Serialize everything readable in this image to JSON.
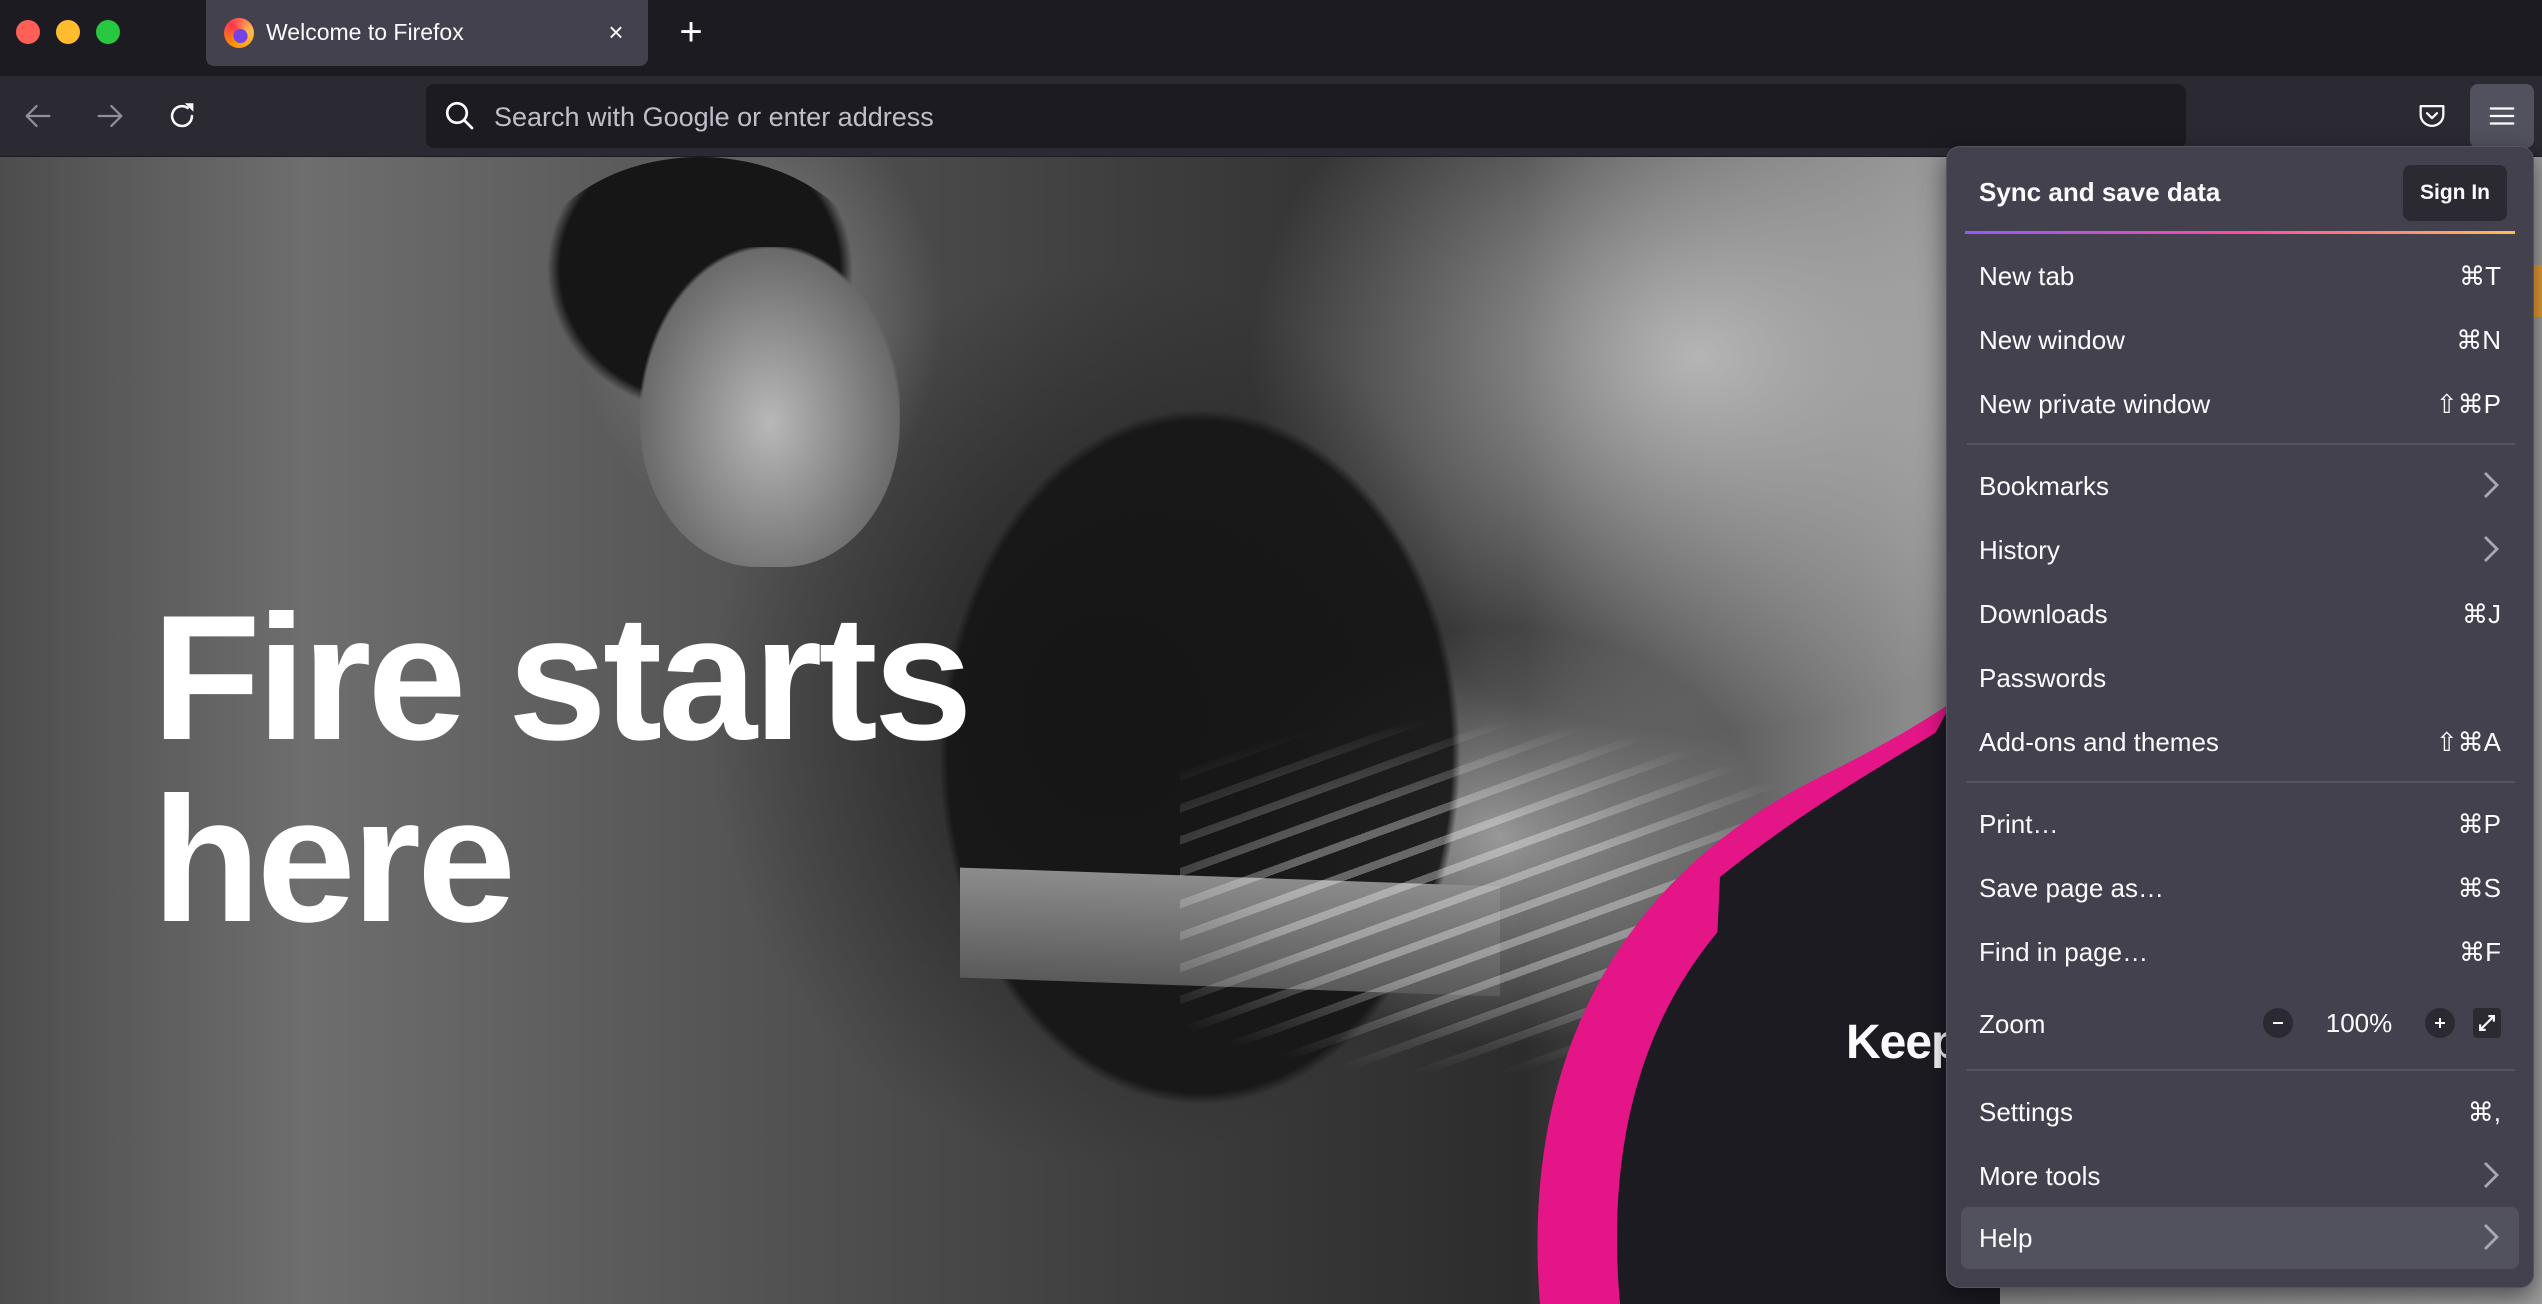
{
  "window": {
    "traffic_lights": [
      "close",
      "minimize",
      "maximize"
    ]
  },
  "tabs": [
    {
      "title": "Welcome to Firefox",
      "icon": "firefox-logo-icon",
      "active": true,
      "close_label": "×"
    }
  ],
  "new_tab_label": "+",
  "toolbar": {
    "back_icon": "arrow-left-icon",
    "forward_icon": "arrow-right-icon",
    "reload_icon": "reload-icon",
    "url_placeholder": "Search with Google or enter address",
    "url_value": "",
    "pocket_icon": "pocket-icon",
    "menu_icon": "hamburger-menu-icon"
  },
  "page": {
    "headline_line1": "Fire starts",
    "headline_line2": "here",
    "side_text": "Keep",
    "accent_color": "#e31587",
    "dark_panel_color": "#1c1b22"
  },
  "app_menu": {
    "sync_label": "Sync and save data",
    "sign_in_label": "Sign In",
    "items": [
      {
        "label": "New tab",
        "shortcut": "⌘T"
      },
      {
        "label": "New window",
        "shortcut": "⌘N"
      },
      {
        "label": "New private window",
        "shortcut": "⇧⌘P"
      },
      {
        "label": "Bookmarks",
        "submenu": true
      },
      {
        "label": "History",
        "submenu": true
      },
      {
        "label": "Downloads",
        "shortcut": "⌘J"
      },
      {
        "label": "Passwords",
        "shortcut": ""
      },
      {
        "label": "Add-ons and themes",
        "shortcut": "⇧⌘A"
      },
      {
        "label": "Print…",
        "shortcut": "⌘P"
      },
      {
        "label": "Save page as…",
        "shortcut": "⌘S"
      },
      {
        "label": "Find in page…",
        "shortcut": "⌘F"
      },
      {
        "label": "Zoom"
      },
      {
        "label": "Settings",
        "shortcut": "⌘,"
      },
      {
        "label": "More tools",
        "submenu": true
      },
      {
        "label": "Help",
        "submenu": true,
        "highlighted": true
      }
    ],
    "zoom": {
      "value": "100%",
      "minus_label": "−",
      "plus_label": "+",
      "fullscreen_icon": "fullscreen-icon"
    }
  }
}
